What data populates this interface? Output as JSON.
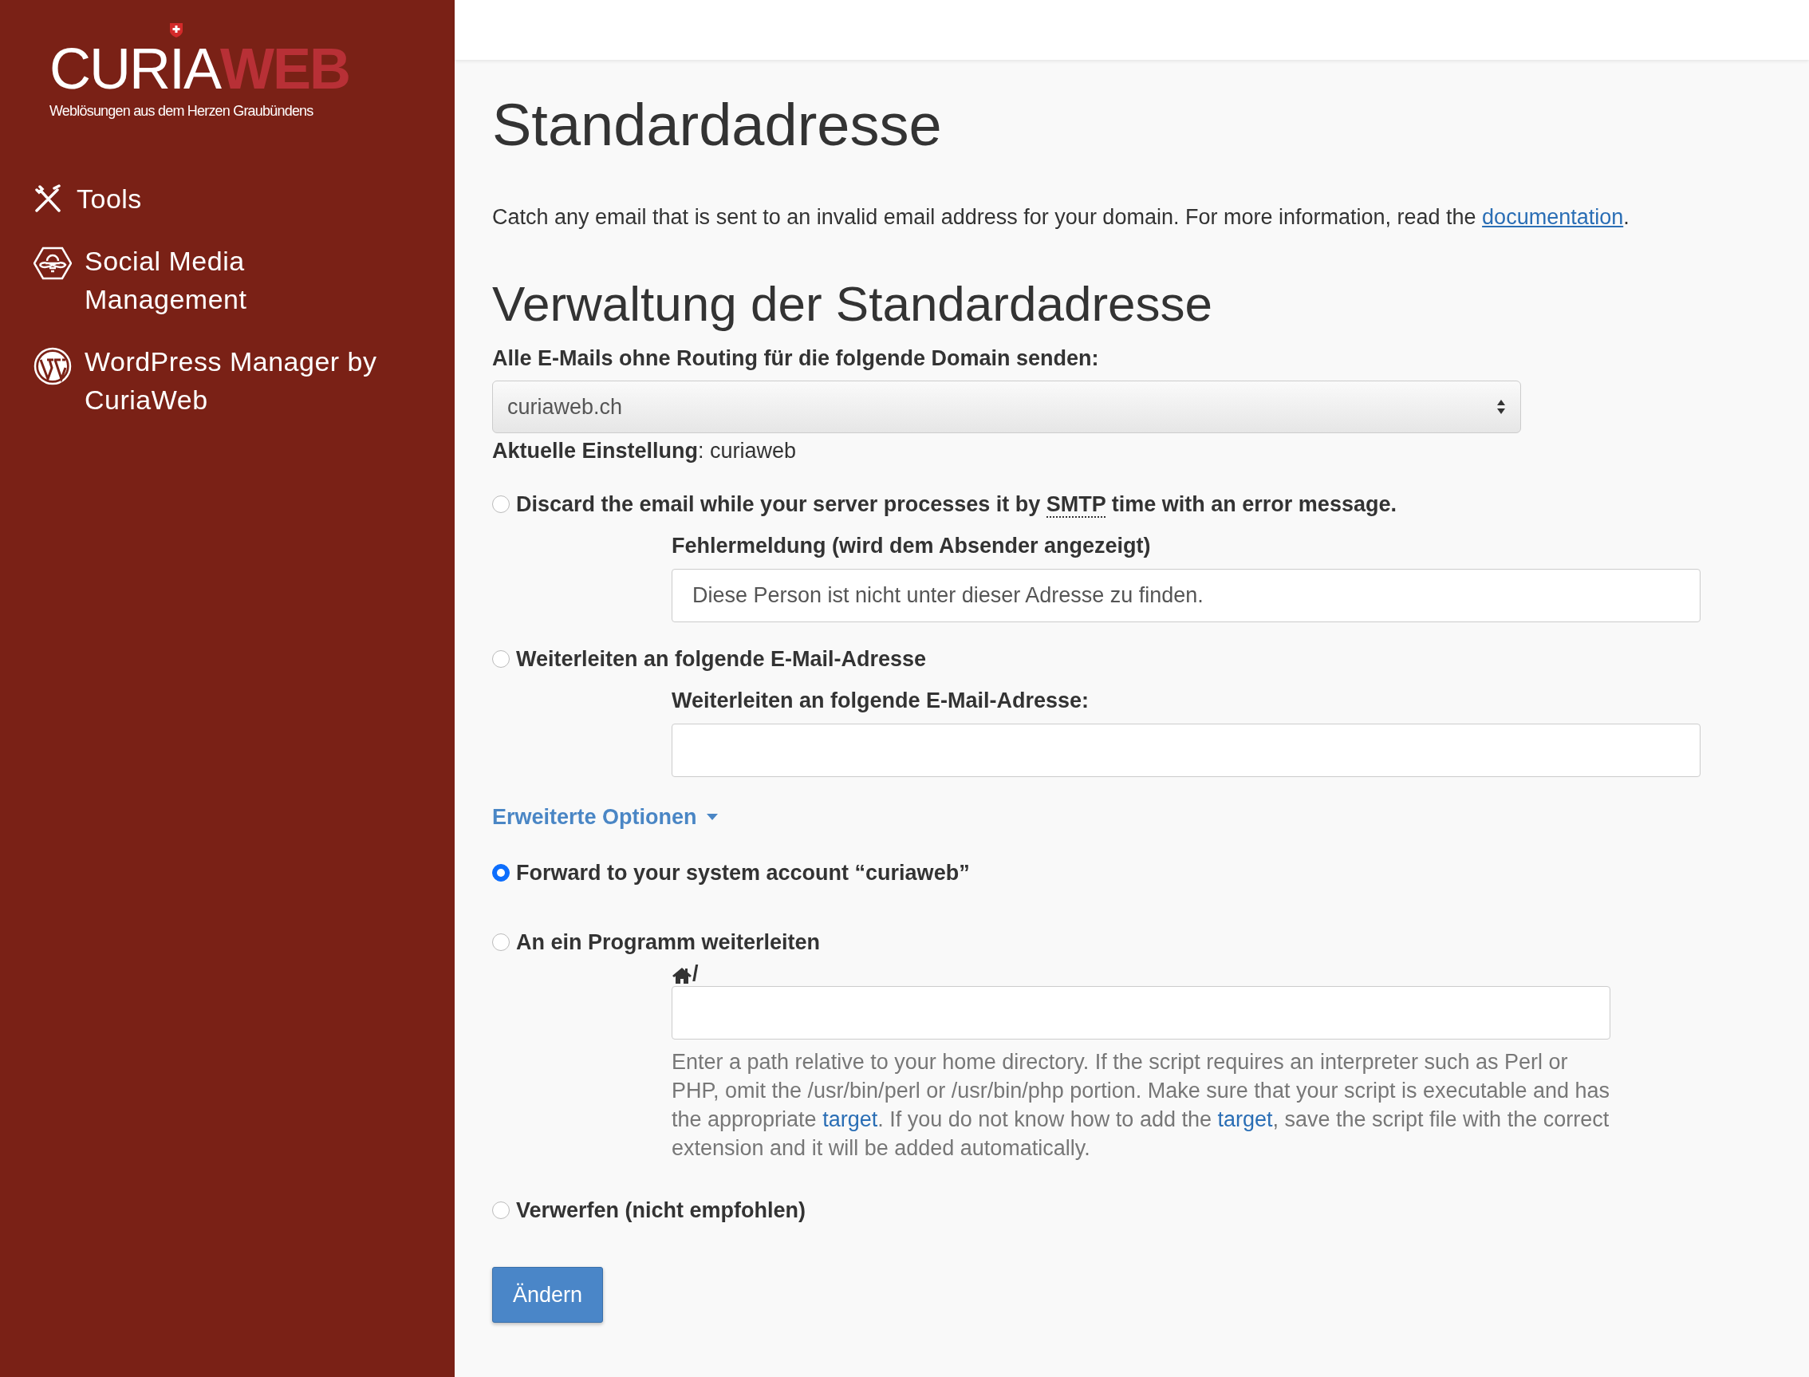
{
  "logo": {
    "name_first": "CURIA",
    "name_second": "WEB",
    "tagline": "Weblösungen aus dem Herzen Graubündens"
  },
  "sidebar": {
    "items": [
      {
        "kind": "tools",
        "label": "Tools"
      },
      {
        "kind": "social",
        "label": "Social Media Management"
      },
      {
        "kind": "wordpress",
        "label": "WordPress Manager by CuriaWeb"
      }
    ]
  },
  "page": {
    "title": "Standardadresse",
    "intro_before": "Catch any email that is sent to an invalid email address for your domain. For more information, read the ",
    "intro_link": "documentation",
    "intro_after": "."
  },
  "section": {
    "title": "Verwaltung der Standardadresse",
    "domain_label": "Alle E-Mails ohne Routing für die folgende Domain senden:",
    "domain_select": {
      "value": "curiaweb.ch"
    },
    "current_setting": "**Aktuelle Einstellung**: curiaweb"
  },
  "options": [
    {
      "kind": "field",
      "selected": false,
      "label_before": "Discard the email while your server processes it by ",
      "abbr": "SMTP",
      "label_after": " time with an error message.",
      "field_label": "Fehlermeldung (wird dem Absender angezeigt)",
      "field_value": "Diese Person ist nicht unter dieser Adresse zu finden."
    },
    {
      "kind": "field",
      "selected": false,
      "label_before": "Weiterleiten an folgende E-Mail-Adresse",
      "field_label": "Weiterleiten an folgende E-Mail-Adresse:"
    }
  ],
  "advanced": {
    "label": "Erweiterte Optionen",
    "expanded": true
  },
  "advanced_options": [
    {
      "kind": "plain",
      "selected": true,
      "label_before": "Forward to your system account “curiaweb”"
    },
    {
      "kind": "program",
      "selected": false,
      "label_before": "An ein Programm weiterleiten",
      "field_prefix": "/",
      "help": [
        {
          "text": "Enter a path relative to your home directory. If the script requires an interpreter such as Perl or PHP, omit the /usr/bin/perl or /usr/bin/php portion. Make sure that your script is executable and has the appropriate "
        },
        {
          "link": "target"
        },
        {
          "text": ". If you do not know how to add the "
        },
        {
          "link": "target"
        },
        {
          "text": ", save the script file with the correct extension and it will be added automatically."
        }
      ]
    },
    {
      "kind": "plain",
      "selected": false,
      "label_before": "Verwerfen (nicht empfohlen)"
    }
  ],
  "submit": {
    "label": "Ändern"
  }
}
